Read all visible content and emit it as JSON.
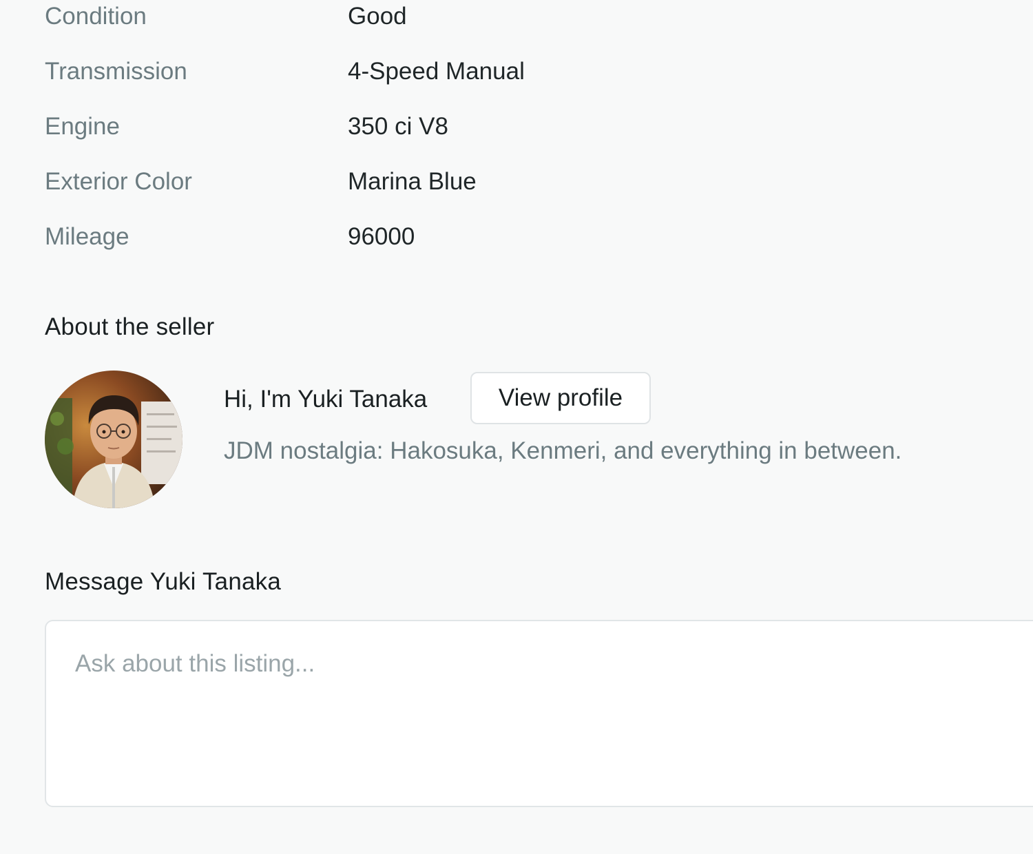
{
  "specs": [
    {
      "label": "Condition",
      "value": "Good"
    },
    {
      "label": "Transmission",
      "value": "4-Speed Manual"
    },
    {
      "label": "Engine",
      "value": "350 ci V8"
    },
    {
      "label": "Exterior Color",
      "value": "Marina Blue"
    },
    {
      "label": "Mileage",
      "value": "96000"
    }
  ],
  "seller": {
    "section_title": "About the seller",
    "greeting": "Hi, I'm Yuki Tanaka",
    "view_profile_label": "View profile",
    "bio": "JDM nostalgia: Hakosuka, Kenmeri, and everything in between."
  },
  "message": {
    "title": "Message Yuki Tanaka",
    "placeholder": "Ask about this listing..."
  },
  "colors": {
    "background": "#f8f9f9",
    "label_text": "#6b7b80",
    "value_text": "#1f2628",
    "border": "#dfe3e5"
  }
}
